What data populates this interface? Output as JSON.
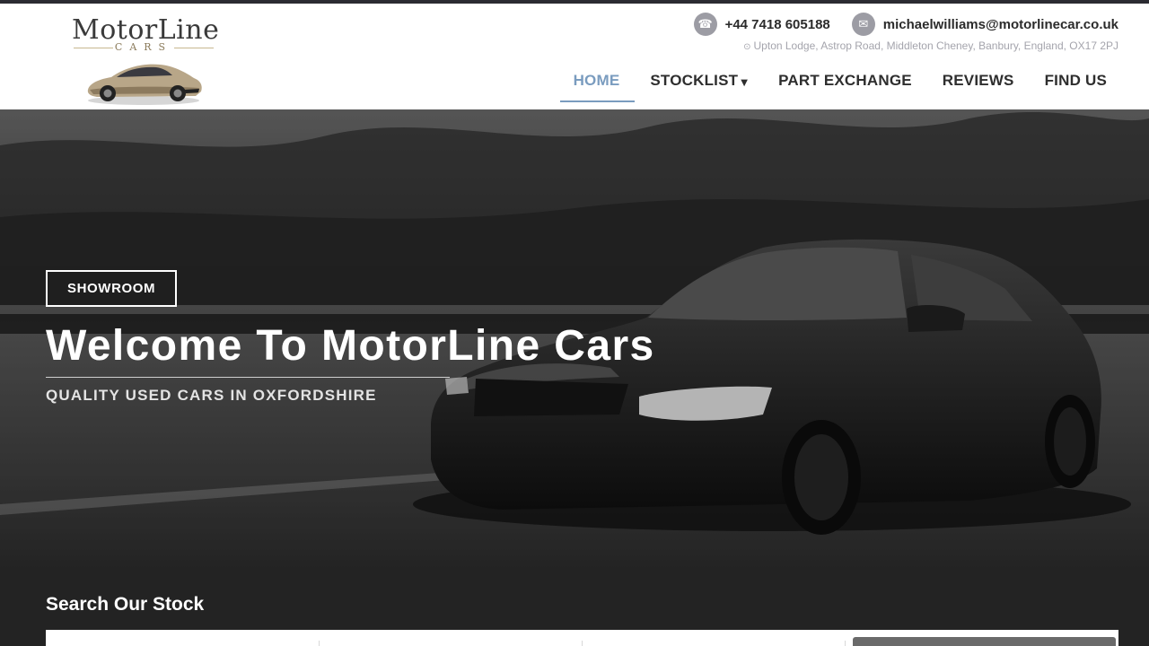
{
  "brand": {
    "name": "MotorLine",
    "tagline": "CARS"
  },
  "contact": {
    "phone_icon": "phone-icon",
    "phone": "+44 7418 605188",
    "email_icon": "envelope-icon",
    "email": "michaelwilliams@motorlinecar.co.uk",
    "address_icon": "location-pin-icon",
    "address": "Upton Lodge, Astrop Road, Middleton Cheney, Banbury, England, OX17 2PJ"
  },
  "nav": {
    "items": [
      {
        "label": "HOME",
        "active": true
      },
      {
        "label": "STOCKLIST",
        "has_dropdown": true
      },
      {
        "label": "PART EXCHANGE"
      },
      {
        "label": "REVIEWS"
      },
      {
        "label": "FIND US"
      }
    ],
    "active_color": "#7a9cbf"
  },
  "hero": {
    "button_label": "SHOWROOM",
    "title": "Welcome To MotorLine Cars",
    "subtitle": "QUALITY USED CARS IN OXFORDSHIRE"
  },
  "search": {
    "title": "Search Our Stock"
  },
  "colors": {
    "topbar": "#2b2b32",
    "search_bg": "#232323",
    "accent": "#7a9cbf"
  }
}
